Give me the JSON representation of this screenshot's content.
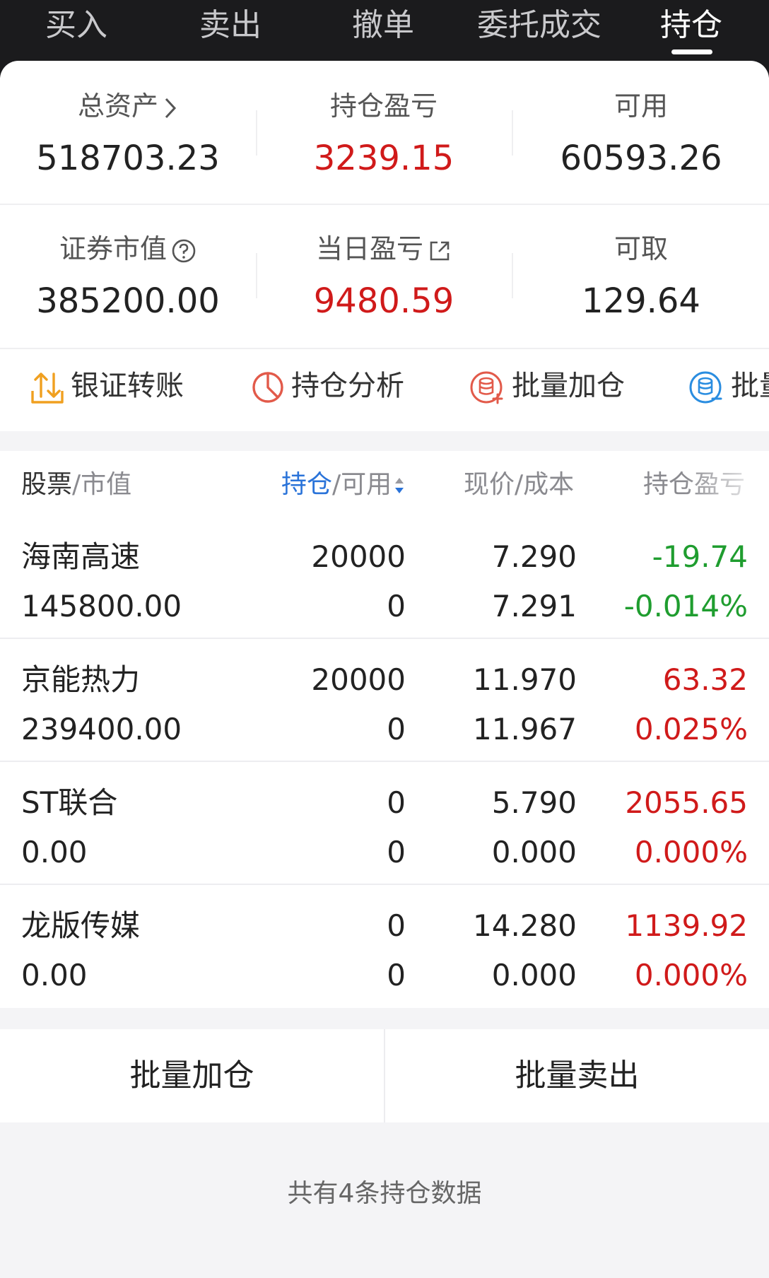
{
  "tabs": [
    {
      "label": "买入"
    },
    {
      "label": "卖出"
    },
    {
      "label": "撤单"
    },
    {
      "label": "委托成交"
    },
    {
      "label": "持仓",
      "active": true
    }
  ],
  "summary": {
    "total_assets": {
      "label": "总资产",
      "value": "518703.23"
    },
    "position_pnl": {
      "label": "持仓盈亏",
      "value": "3239.15"
    },
    "available": {
      "label": "可用",
      "value": "60593.26"
    },
    "securities_value": {
      "label": "证券市值",
      "value": "385200.00"
    },
    "daily_pnl": {
      "label": "当日盈亏",
      "value": "9480.59"
    },
    "withdrawable": {
      "label": "可取",
      "value": "129.64"
    }
  },
  "actions": [
    {
      "label": "银证转账",
      "icon": "transfer-icon"
    },
    {
      "label": "持仓分析",
      "icon": "pie-chart-icon"
    },
    {
      "label": "批量加仓",
      "icon": "batch-add-icon"
    },
    {
      "label": "批量",
      "icon": "batch-sell-icon"
    }
  ],
  "table": {
    "headers": {
      "col1_main": "股票",
      "col1_sub": "/市值",
      "col2_main": "持仓",
      "col2_sub": "/可用",
      "col3": "现价/成本",
      "col4": "持仓盈亏"
    },
    "rows": [
      {
        "name": "海南高速",
        "market_value": "145800.00",
        "position": "20000",
        "available": "0",
        "price": "7.290",
        "cost": "7.291",
        "pnl": "-19.74",
        "pnl_pct": "-0.014%",
        "trend": "down"
      },
      {
        "name": "京能热力",
        "market_value": "239400.00",
        "position": "20000",
        "available": "0",
        "price": "11.970",
        "cost": "11.967",
        "pnl": "63.32",
        "pnl_pct": "0.025%",
        "trend": "up"
      },
      {
        "name": "ST联合",
        "market_value": "0.00",
        "position": "0",
        "available": "0",
        "price": "5.790",
        "cost": "0.000",
        "pnl": "2055.65",
        "pnl_pct": "0.000%",
        "trend": "up"
      },
      {
        "name": "龙版传媒",
        "market_value": "0.00",
        "position": "0",
        "available": "0",
        "price": "14.280",
        "cost": "0.000",
        "pnl": "1139.92",
        "pnl_pct": "0.000%",
        "trend": "up"
      }
    ]
  },
  "buttons": {
    "batch_add": "批量加仓",
    "batch_sell": "批量卖出"
  },
  "footer": "共有4条持仓数据",
  "colors": {
    "up": "#d01a1a",
    "down": "#1f9d2f",
    "accent": "#2a73d9",
    "action_orange": "#f0a020",
    "action_red": "#e25a4a",
    "action_blue": "#2a8de0"
  }
}
